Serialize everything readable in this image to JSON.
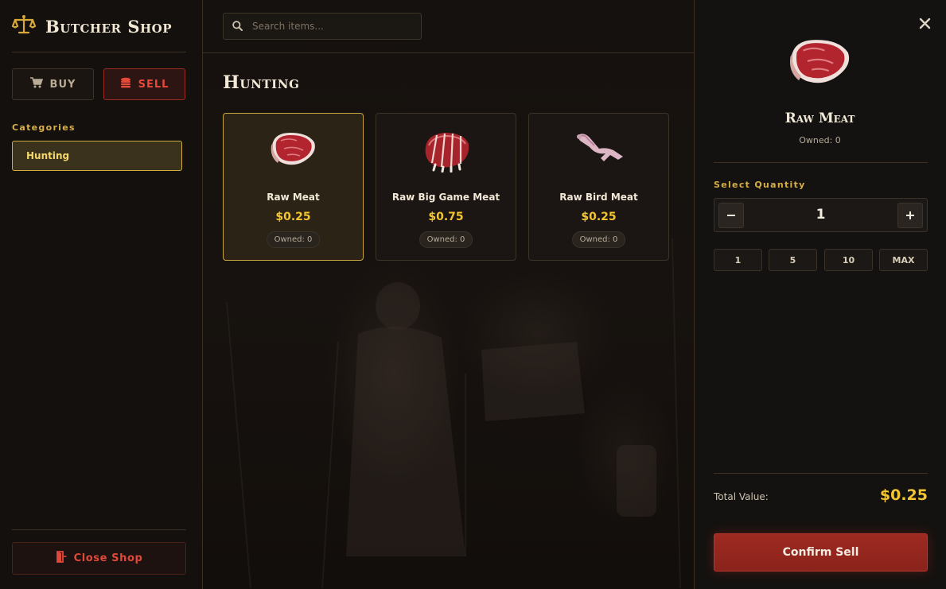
{
  "shop": {
    "title": "Butcher Shop",
    "logo_icon": "scales-icon"
  },
  "mode_tabs": {
    "buy": {
      "label": "BUY",
      "icon": "cart-icon"
    },
    "sell": {
      "label": "SELL",
      "icon": "coins-icon",
      "active": true
    }
  },
  "categories": {
    "heading": "Categories",
    "items": [
      {
        "label": "Hunting",
        "selected": true
      }
    ]
  },
  "close_shop": {
    "label": "Close Shop",
    "icon": "door-exit-icon"
  },
  "search": {
    "placeholder": "Search items...",
    "value": ""
  },
  "section": {
    "title": "Hunting"
  },
  "items": [
    {
      "name": "Raw Meat",
      "price": "$0.25",
      "owned": "Owned: 0",
      "icon": "steak-icon",
      "selected": true
    },
    {
      "name": "Raw Big Game Meat",
      "price": "$0.75",
      "owned": "Owned: 0",
      "icon": "roast-icon"
    },
    {
      "name": "Raw Bird Meat",
      "price": "$0.25",
      "owned": "Owned: 0",
      "icon": "bird-carcass-icon"
    }
  ],
  "detail": {
    "name": "Raw Meat",
    "owned": "Owned: 0",
    "quantity_heading": "Select Quantity",
    "quantity": "1",
    "presets": [
      "1",
      "5",
      "10",
      "MAX"
    ],
    "total_label": "Total Value:",
    "total_value": "$0.25",
    "confirm_label": "Confirm Sell"
  },
  "colors": {
    "gold_accent": "#d8b04a",
    "price_yellow": "#f2c530",
    "sell_red": "#e6493a",
    "confirm_red": "#9e2a21"
  }
}
